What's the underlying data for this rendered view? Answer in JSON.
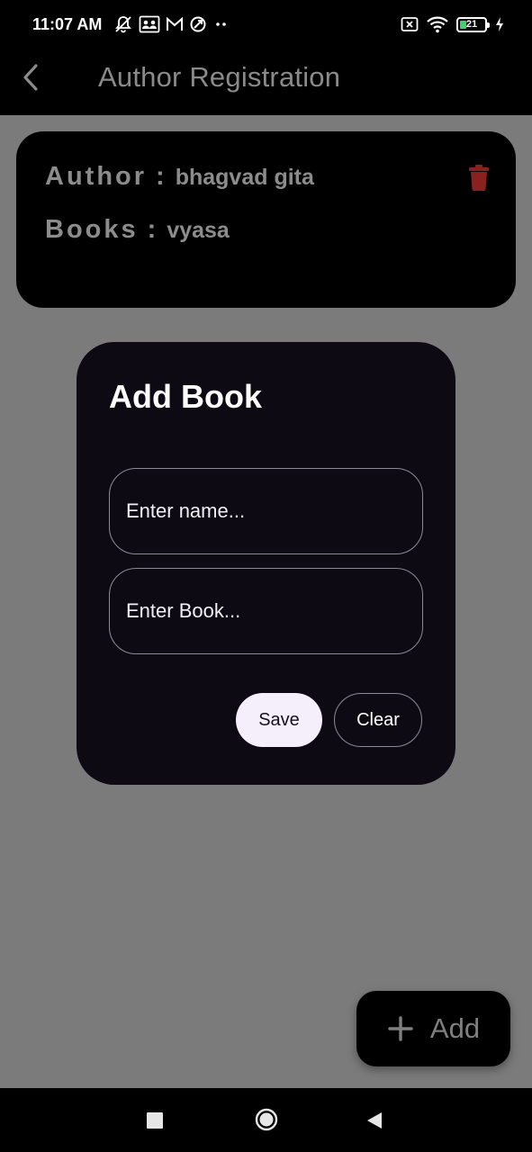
{
  "status_bar": {
    "time": "11:07 AM",
    "left_icons": [
      "muted-bell-icon",
      "contacts-sync-icon",
      "gmail-icon",
      "data-saver-icon",
      "more-dots-icon"
    ],
    "right_icons": [
      "sim-none-icon",
      "wifi-icon",
      "battery-icon",
      "charging-icon"
    ],
    "battery_level": "21"
  },
  "app_bar": {
    "back_icon": "chevron-left-icon",
    "title": "Author Registration"
  },
  "author_card": {
    "author_label": "Author",
    "author_value": "bhagvad gita",
    "books_label": "Books",
    "books_value": "vyasa",
    "separator": ":",
    "delete_icon": "trash-icon",
    "delete_color": "#8b2020"
  },
  "dialog": {
    "title": "Add Book",
    "name_placeholder": "Enter name...",
    "book_placeholder": "Enter Book...",
    "save_label": "Save",
    "clear_label": "Clear"
  },
  "fab": {
    "icon": "plus-icon",
    "label": "Add"
  },
  "nav_bar": {
    "items": [
      "recents-square-icon",
      "home-circle-icon",
      "back-triangle-icon"
    ]
  },
  "colors": {
    "scrim": "#7b7b7b",
    "dialog_bg": "#0e0a14",
    "save_button_bg": "#f5eefb"
  }
}
